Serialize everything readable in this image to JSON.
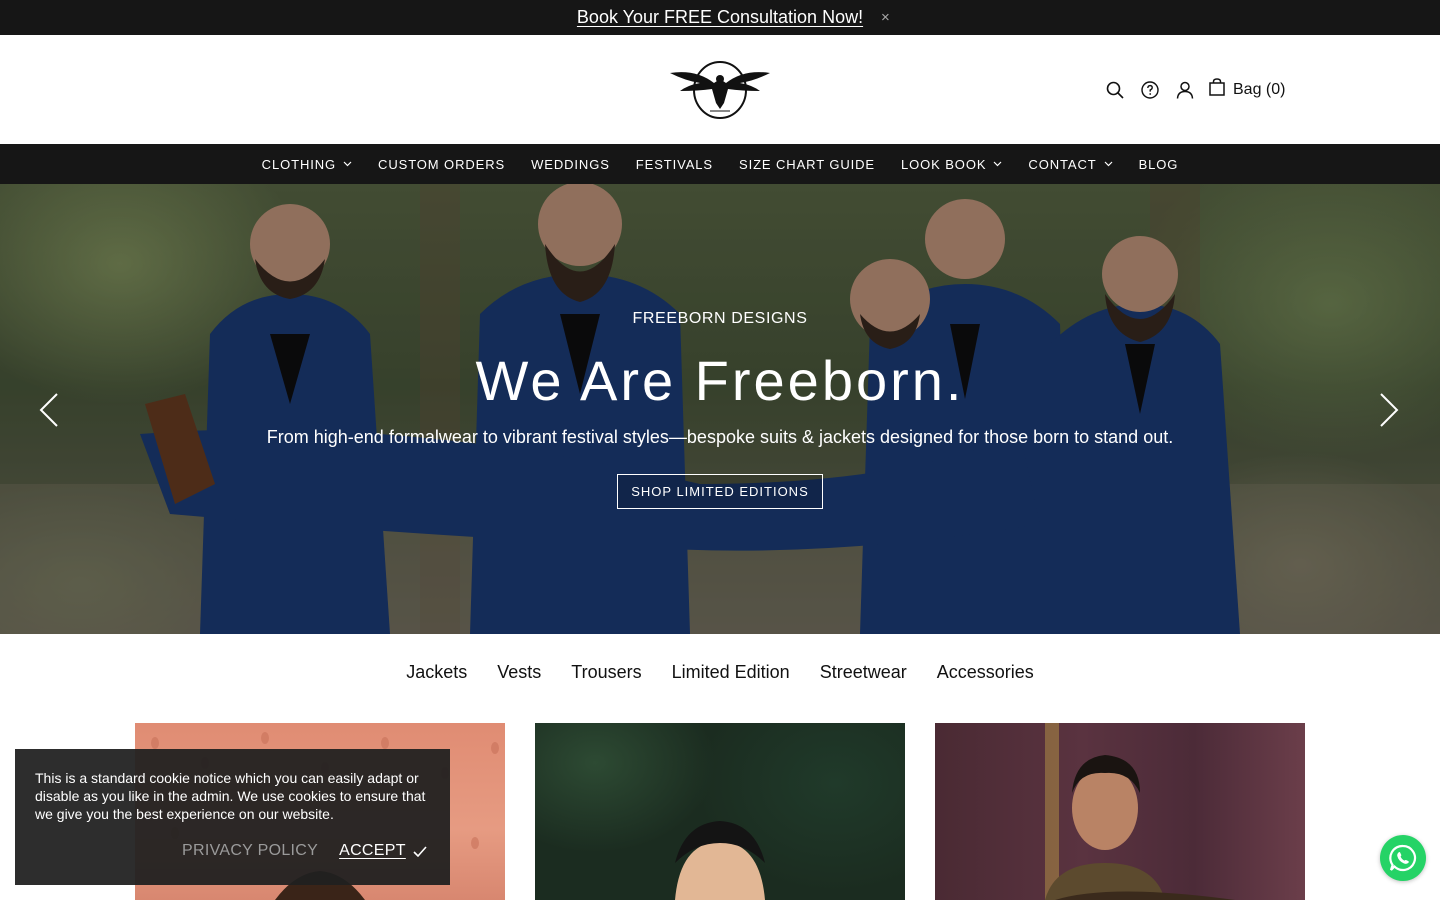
{
  "announcement": {
    "text": "Book Your FREE Consultation Now!",
    "close": "×"
  },
  "header": {
    "logo_text": "FREEBORN",
    "icons": [
      "search-icon",
      "help-icon",
      "account-icon",
      "bag-icon"
    ],
    "bag_label": "Bag (0)"
  },
  "nav": {
    "items": [
      {
        "label": "CLOTHING",
        "dropdown": true
      },
      {
        "label": "CUSTOM ORDERS",
        "dropdown": false
      },
      {
        "label": "WEDDINGS",
        "dropdown": false
      },
      {
        "label": "FESTIVALS",
        "dropdown": false
      },
      {
        "label": "SIZE CHART GUIDE",
        "dropdown": false
      },
      {
        "label": "LOOK BOOK",
        "dropdown": true
      },
      {
        "label": "CONTACT",
        "dropdown": true
      },
      {
        "label": "BLOG",
        "dropdown": false
      }
    ]
  },
  "hero": {
    "eyebrow": "FREEBORN DESIGNS",
    "title": "We Are Freeborn.",
    "subtitle": "From high-end formalwear to vibrant festival styles—bespoke suits & jackets designed for those born to stand out.",
    "button": "SHOP LIMITED EDITIONS"
  },
  "categories": [
    "Jackets",
    "Vests",
    "Trousers",
    "Limited Edition",
    "Streetwear",
    "Accessories"
  ],
  "cookie": {
    "text": "This is a standard cookie notice which you can easily adapt or disable as you like in the admin. We use cookies to ensure that we give you the best experience on our website.",
    "privacy": "PRIVACY POLICY",
    "accept": "ACCEPT"
  },
  "colors": {
    "dark": "#161616",
    "white": "#ffffff",
    "whatsapp": "#25d366"
  }
}
